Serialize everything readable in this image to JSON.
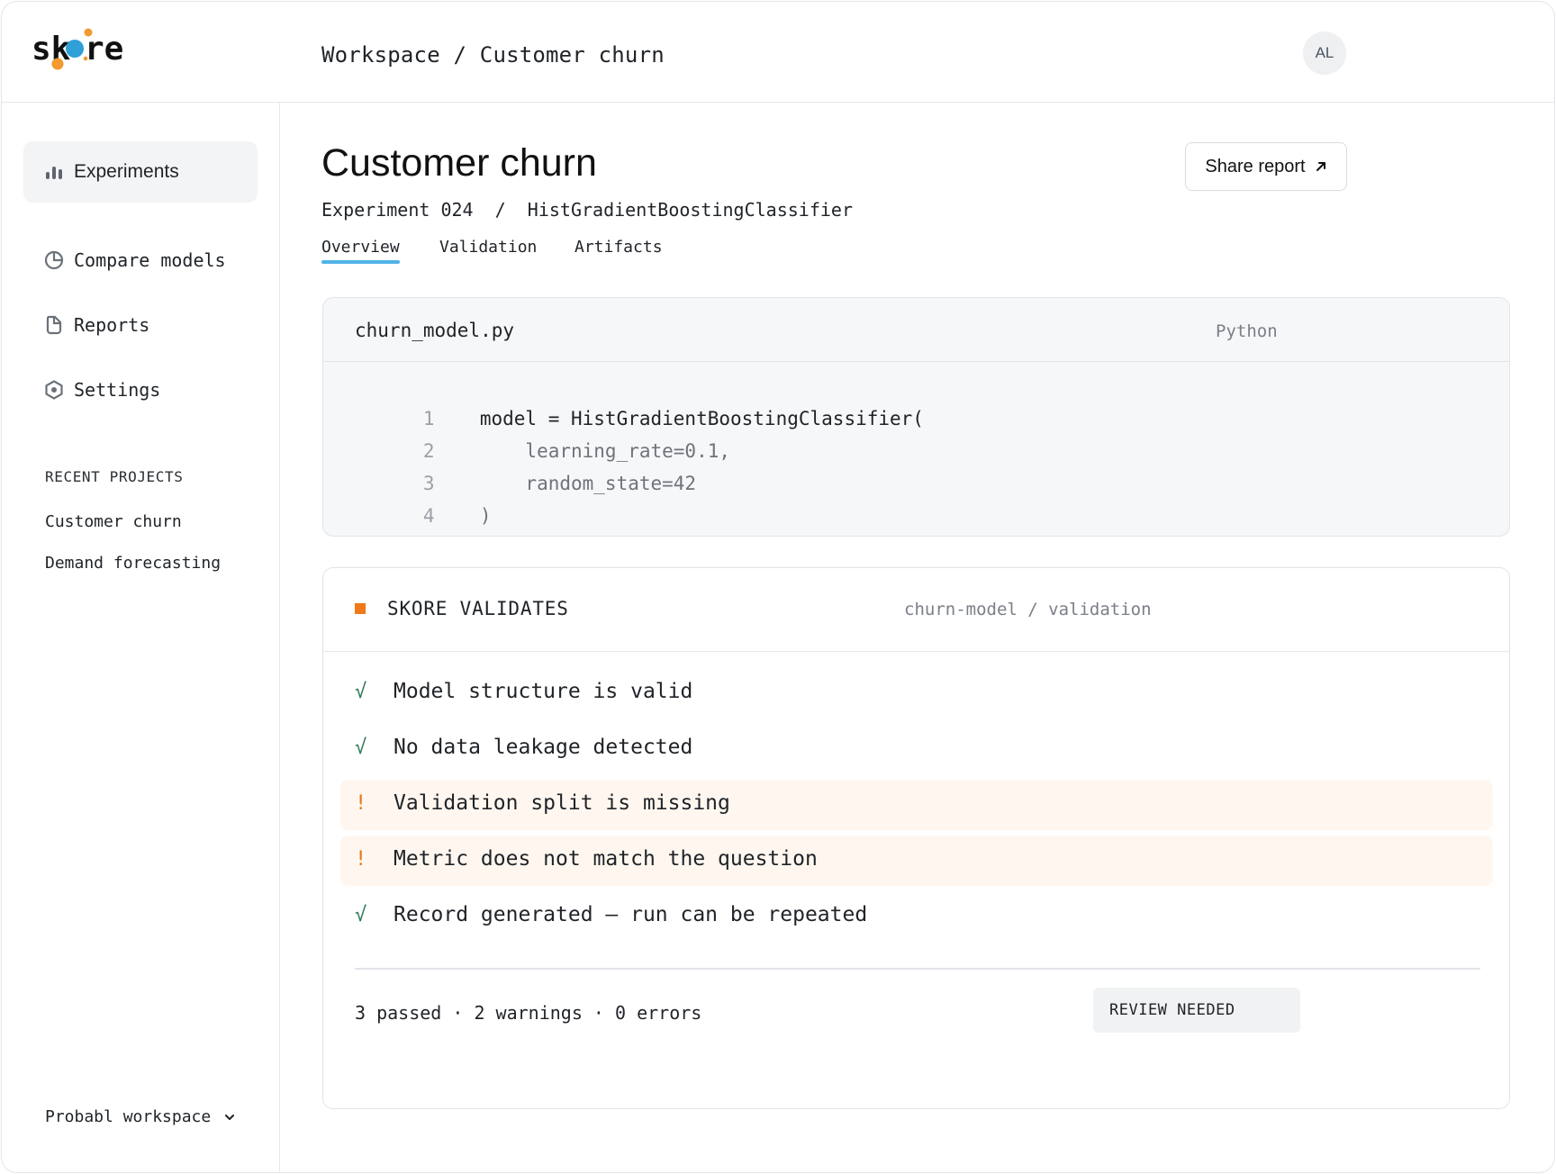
{
  "app": {
    "logo_text": "skore"
  },
  "header": {
    "breadcrumb": "Workspace / Customer churn",
    "avatar_initials": "AL"
  },
  "sidebar": {
    "nav": [
      {
        "label": "Experiments",
        "icon": "bar-chart-icon",
        "active": true
      },
      {
        "label": "Compare models",
        "icon": "pie-chart-icon",
        "active": false
      },
      {
        "label": "Reports",
        "icon": "document-icon",
        "active": false
      },
      {
        "label": "Settings",
        "icon": "hexagon-settings-icon",
        "active": false
      }
    ],
    "recent_label": "RECENT PROJECTS",
    "recent_projects": [
      "Customer churn",
      "Demand forecasting"
    ],
    "workspace": "Probabl workspace"
  },
  "page": {
    "title": "Customer churn",
    "subtitle": "Experiment 024  /  HistGradientBoostingClassifier",
    "share_label": "Share report",
    "tabs": [
      {
        "label": "Overview",
        "active": true
      },
      {
        "label": "Validation",
        "active": false
      },
      {
        "label": "Artifacts",
        "active": false
      }
    ]
  },
  "code": {
    "filename": "churn_model.py",
    "language": "Python",
    "lines": [
      {
        "num": "1",
        "text": "model = HistGradientBoostingClassifier("
      },
      {
        "num": "2",
        "text": "    learning_rate=0.1,"
      },
      {
        "num": "3",
        "text": "    random_state=42"
      },
      {
        "num": "4",
        "text": ")"
      }
    ]
  },
  "validation": {
    "title": "SKORE VALIDATES",
    "path": "churn-model / validation",
    "checks": [
      {
        "status": "pass",
        "symbol": "√",
        "text": "Model structure is valid"
      },
      {
        "status": "pass",
        "symbol": "√",
        "text": "No data leakage detected"
      },
      {
        "status": "warning",
        "symbol": "!",
        "text": "Validation split is missing"
      },
      {
        "status": "warning",
        "symbol": "!",
        "text": "Metric does not match the question"
      },
      {
        "status": "pass",
        "symbol": "√",
        "text": "Record generated — run can be repeated"
      }
    ],
    "summary": "3 passed · 2 warnings · 0 errors",
    "badge": "REVIEW NEEDED"
  },
  "colors": {
    "accent": "#4fb3e8",
    "warning": "#f07818",
    "pass": "#2f7a5a",
    "logo_blue": "#2f9fd8",
    "logo_orange": "#f39a2e"
  }
}
